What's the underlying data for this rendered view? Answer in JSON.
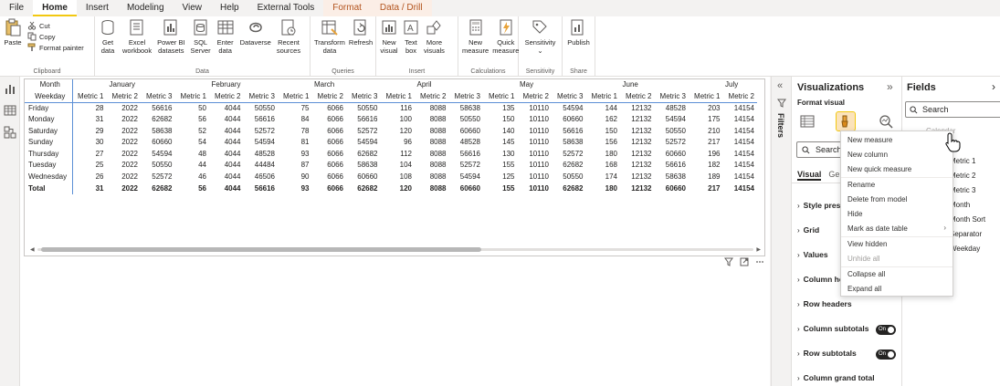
{
  "menubar": {
    "tabs": [
      "File",
      "Home",
      "Insert",
      "Modeling",
      "View",
      "Help",
      "External Tools",
      "Format",
      "Data / Drill"
    ],
    "active": "Home"
  },
  "ribbon": {
    "clipboard": {
      "paste": "Paste",
      "cut": "Cut",
      "copy": "Copy",
      "format_painter": "Format painter",
      "group": "Clipboard"
    },
    "data": {
      "get_data": [
        "Get",
        "data"
      ],
      "excel": [
        "Excel",
        "workbook"
      ],
      "powerbi": [
        "Power BI",
        "datasets"
      ],
      "sql": [
        "SQL",
        "Server"
      ],
      "enter_data": [
        "Enter",
        "data"
      ],
      "dataverse": [
        "Dataverse",
        ""
      ],
      "recent": [
        "Recent",
        "sources"
      ],
      "group": "Data"
    },
    "queries": {
      "transform": [
        "Transform",
        "data"
      ],
      "refresh": [
        "Refresh",
        ""
      ],
      "group": "Queries"
    },
    "insert": {
      "new_visual": [
        "New",
        "visual"
      ],
      "text_box": [
        "Text",
        "box"
      ],
      "more_visuals": [
        "More",
        "visuals"
      ],
      "group": "Insert"
    },
    "calculations": {
      "new_measure": [
        "New",
        "measure"
      ],
      "quick_measure": [
        "Quick",
        "measure"
      ],
      "group": "Calculations"
    },
    "sensitivity": {
      "label": [
        "Sensitivity",
        ""
      ],
      "group": "Sensitivity"
    },
    "share": {
      "publish": [
        "Publish",
        ""
      ],
      "group": "Share"
    }
  },
  "matrix": {
    "corner_top": "Month",
    "corner_bottom": "Weekday",
    "months": [
      "January",
      "February",
      "March",
      "April",
      "May",
      "June",
      "July"
    ],
    "metrics": [
      "Metric 1",
      "Metric 2",
      "Metric 3"
    ],
    "rows": [
      {
        "label": "Friday",
        "values": [
          "28",
          "2022",
          "56616",
          "50",
          "4044",
          "50550",
          "75",
          "6066",
          "50550",
          "116",
          "8088",
          "58638",
          "135",
          "10110",
          "54594",
          "144",
          "12132",
          "48528",
          "203",
          "14154"
        ]
      },
      {
        "label": "Monday",
        "values": [
          "31",
          "2022",
          "62682",
          "56",
          "4044",
          "56616",
          "84",
          "6066",
          "56616",
          "100",
          "8088",
          "50550",
          "150",
          "10110",
          "60660",
          "162",
          "12132",
          "54594",
          "175",
          "14154"
        ]
      },
      {
        "label": "Saturday",
        "values": [
          "29",
          "2022",
          "58638",
          "52",
          "4044",
          "52572",
          "78",
          "6066",
          "52572",
          "120",
          "8088",
          "60660",
          "140",
          "10110",
          "56616",
          "150",
          "12132",
          "50550",
          "210",
          "14154"
        ]
      },
      {
        "label": "Sunday",
        "values": [
          "30",
          "2022",
          "60660",
          "54",
          "4044",
          "54594",
          "81",
          "6066",
          "54594",
          "96",
          "8088",
          "48528",
          "145",
          "10110",
          "58638",
          "156",
          "12132",
          "52572",
          "217",
          "14154"
        ]
      },
      {
        "label": "Thursday",
        "values": [
          "27",
          "2022",
          "54594",
          "48",
          "4044",
          "48528",
          "93",
          "6066",
          "62682",
          "112",
          "8088",
          "56616",
          "130",
          "10110",
          "52572",
          "180",
          "12132",
          "60660",
          "196",
          "14154"
        ]
      },
      {
        "label": "Tuesday",
        "values": [
          "25",
          "2022",
          "50550",
          "44",
          "4044",
          "44484",
          "87",
          "6066",
          "58638",
          "104",
          "8088",
          "52572",
          "155",
          "10110",
          "62682",
          "168",
          "12132",
          "56616",
          "182",
          "14154"
        ]
      },
      {
        "label": "Wednesday",
        "values": [
          "26",
          "2022",
          "52572",
          "46",
          "4044",
          "46506",
          "90",
          "6066",
          "60660",
          "108",
          "8088",
          "54594",
          "125",
          "10110",
          "50550",
          "174",
          "12132",
          "58638",
          "189",
          "14154"
        ]
      }
    ],
    "total": {
      "label": "Total",
      "values": [
        "31",
        "2022",
        "62682",
        "56",
        "4044",
        "56616",
        "93",
        "6066",
        "62682",
        "120",
        "8088",
        "60660",
        "155",
        "10110",
        "62682",
        "180",
        "12132",
        "60660",
        "217",
        "14154"
      ]
    }
  },
  "filters": {
    "label": "Filters"
  },
  "viz": {
    "title": "Visualizations",
    "format_visual": "Format visual",
    "search_placeholder": "Search",
    "tab_visual": "Visual",
    "tab_general": "Ge",
    "sections": [
      "Style prese",
      "Grid",
      "Values",
      "Column he",
      "Row headers",
      "Column subtotals",
      "Row subtotals",
      "Column grand total"
    ],
    "toggle_on": "On"
  },
  "fields": {
    "title": "Fields",
    "search_placeholder": "Search",
    "items": [
      "Calendar",
      "e",
      "Metric 1",
      "Metric 2",
      "Metric 3",
      "Month",
      "Month Sort",
      "Separator",
      "Weekday"
    ]
  },
  "context_menu": {
    "items": [
      "New measure",
      "New column",
      "New quick measure",
      "Rename",
      "Delete from model",
      "Hide",
      "Mark as date table",
      "View hidden",
      "Unhide all",
      "Collapse all",
      "Expand all"
    ]
  },
  "colors": {
    "accent": "#f2c811",
    "context_tab": "#b3541e",
    "matrix_line": "#5c8fd6"
  }
}
